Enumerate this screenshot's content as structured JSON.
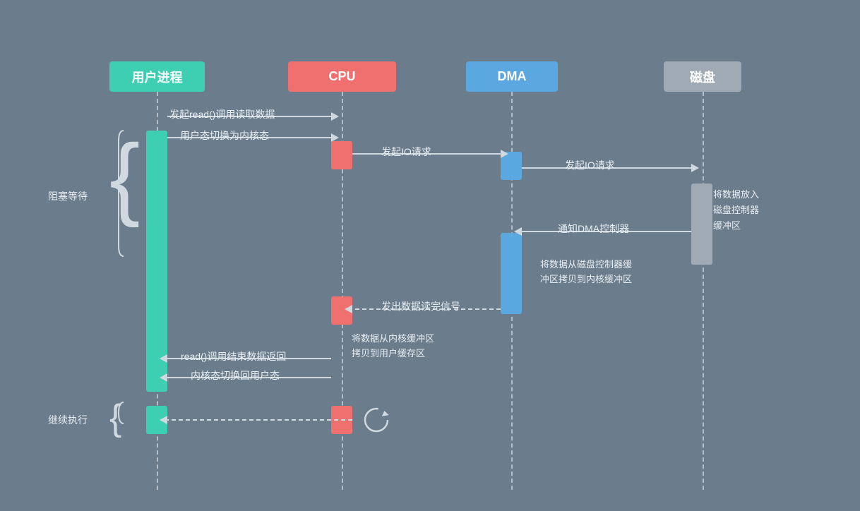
{
  "headers": {
    "user_process": "用户进程",
    "cpu": "CPU",
    "dma": "DMA",
    "disk": "磁盘"
  },
  "labels": {
    "initiate_read": "发起read()调用读取数据",
    "user_to_kernel": "用户态切换为内核态",
    "initiate_io_request_1": "发起IO请求",
    "initiate_io_request_2": "发起IO请求",
    "notify_dma": "通知DMA控制器",
    "put_data_disk_ctrl": "将数据放入\n磁盘控制器\n缓冲区",
    "data_read_done": "发出数据读完信号",
    "copy_kernel_to_user_label": "将数据从内核缓冲区\n拷贝到用户缓存区",
    "dma_copy_label": "将数据从磁盘控制器缓\n冲区拷贝到内核缓冲区",
    "read_return": "read()调用结束数据返回",
    "kernel_to_user": "内核态切换回用户态",
    "blocking": "阻塞等待",
    "continue_exec": "继续执行"
  }
}
